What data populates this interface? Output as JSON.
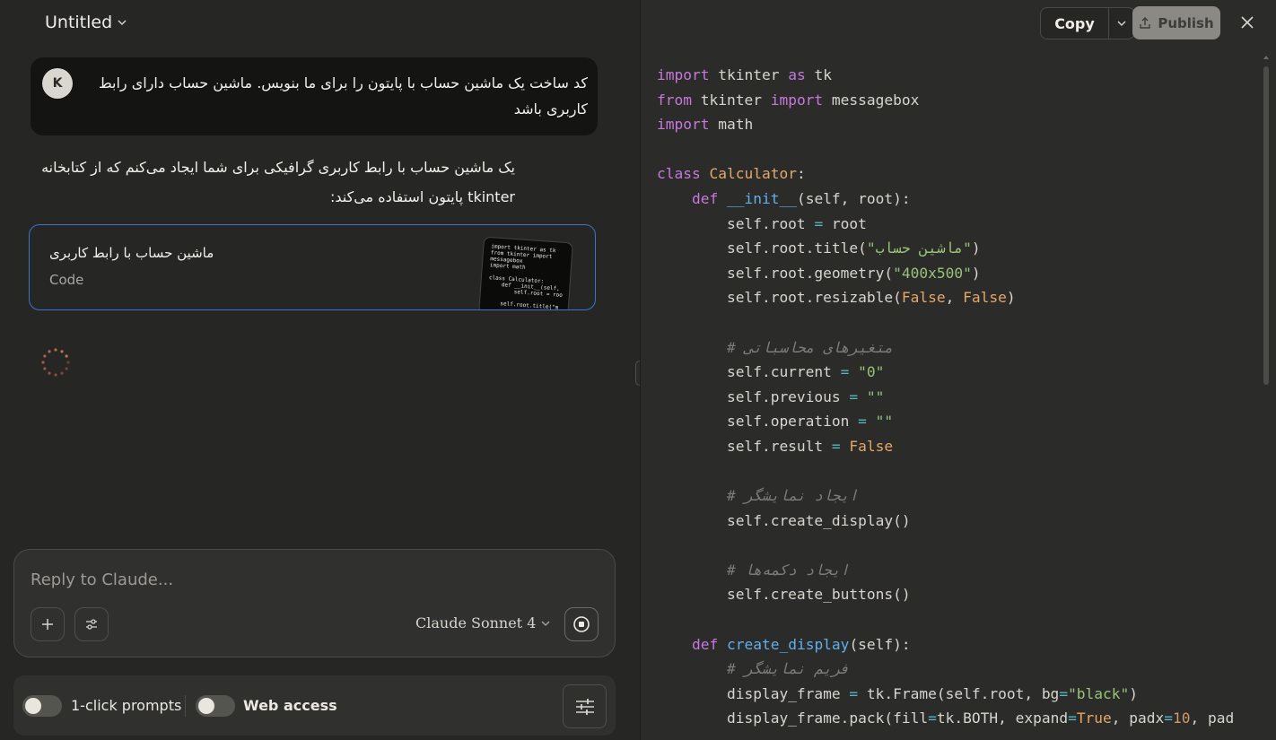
{
  "header": {
    "title": "Untitled"
  },
  "chat": {
    "user": {
      "avatar_letter": "K",
      "text": "کد ساخت یک ماشین حساب با پایتون را برای ما بنویس. ماشین حساب دارای رابط کاربری باشد"
    },
    "assistant": {
      "text": "یک ماشین حساب با رابط کاربری گرافیکی برای شما ایجاد می‌کنم که از کتابخانه tkinter پایتون استفاده می‌کند:"
    },
    "artifact": {
      "title": "ماشین حساب با رابط کاربری",
      "type": "Code",
      "thumbnail_code": "import tkinter as tk\nfrom tkinter import\nmessagebox\nimport math\n\nclass Calculator:\n    def __init__(self,\n        self.root = roo\n\n    self.root.title(\"m"
    }
  },
  "composer": {
    "placeholder": "Reply to Claude...",
    "model": "Claude Sonnet 4"
  },
  "bottom_bar": {
    "one_click_label": "1-click prompts",
    "web_access_label": "Web access"
  },
  "artifact_panel": {
    "copy_label": "Copy",
    "publish_label": "Publish",
    "code_lines": [
      [
        [
          "kw",
          "import"
        ],
        [
          "p",
          " tkinter "
        ],
        [
          "kw",
          "as"
        ],
        [
          "p",
          " tk"
        ]
      ],
      [
        [
          "kw",
          "from"
        ],
        [
          "p",
          " tkinter "
        ],
        [
          "kw",
          "import"
        ],
        [
          "p",
          " messagebox"
        ]
      ],
      [
        [
          "kw",
          "import"
        ],
        [
          "p",
          " math"
        ]
      ],
      [],
      [
        [
          "kw",
          "class"
        ],
        [
          "p",
          " "
        ],
        [
          "cls",
          "Calculator"
        ],
        [
          "p",
          ":"
        ]
      ],
      [
        [
          "p",
          "    "
        ],
        [
          "kw",
          "def"
        ],
        [
          "p",
          " "
        ],
        [
          "fn",
          "__init__"
        ],
        [
          "p",
          "(self, root):"
        ]
      ],
      [
        [
          "p",
          "        self.root "
        ],
        [
          "op",
          "="
        ],
        [
          "p",
          " root"
        ]
      ],
      [
        [
          "p",
          "        self.root.title("
        ],
        [
          "str",
          "\"ماشین حساب\""
        ],
        [
          "p",
          ")"
        ]
      ],
      [
        [
          "p",
          "        self.root.geometry("
        ],
        [
          "str",
          "\"400x500\""
        ],
        [
          "p",
          ")"
        ]
      ],
      [
        [
          "p",
          "        self.root.resizable("
        ],
        [
          "bool",
          "False"
        ],
        [
          "p",
          ", "
        ],
        [
          "bool",
          "False"
        ],
        [
          "p",
          ")"
        ]
      ],
      [],
      [
        [
          "p",
          "        "
        ],
        [
          "cm",
          "# متغیرهای محاسباتی"
        ]
      ],
      [
        [
          "p",
          "        self.current "
        ],
        [
          "op",
          "="
        ],
        [
          "p",
          " "
        ],
        [
          "str",
          "\"0\""
        ]
      ],
      [
        [
          "p",
          "        self.previous "
        ],
        [
          "op",
          "="
        ],
        [
          "p",
          " "
        ],
        [
          "str",
          "\"\""
        ]
      ],
      [
        [
          "p",
          "        self.operation "
        ],
        [
          "op",
          "="
        ],
        [
          "p",
          " "
        ],
        [
          "str",
          "\"\""
        ]
      ],
      [
        [
          "p",
          "        self.result "
        ],
        [
          "op",
          "="
        ],
        [
          "p",
          " "
        ],
        [
          "bool",
          "False"
        ]
      ],
      [],
      [
        [
          "p",
          "        "
        ],
        [
          "cm",
          "# ایجاد نمایشگر"
        ]
      ],
      [
        [
          "p",
          "        self.create_display()"
        ]
      ],
      [],
      [
        [
          "p",
          "        "
        ],
        [
          "cm",
          "# ایجاد دکمه‌ها"
        ]
      ],
      [
        [
          "p",
          "        self.create_buttons()"
        ]
      ],
      [],
      [
        [
          "p",
          "    "
        ],
        [
          "kw",
          "def"
        ],
        [
          "p",
          " "
        ],
        [
          "fn",
          "create_display"
        ],
        [
          "p",
          "(self):"
        ]
      ],
      [
        [
          "p",
          "        "
        ],
        [
          "cm",
          "# فریم نمایشگر"
        ]
      ],
      [
        [
          "p",
          "        display_frame "
        ],
        [
          "op",
          "="
        ],
        [
          "p",
          " tk.Frame(self.root, bg"
        ],
        [
          "op",
          "="
        ],
        [
          "str",
          "\"black\""
        ],
        [
          "p",
          ")"
        ]
      ],
      [
        [
          "p",
          "        display_frame.pack(fill"
        ],
        [
          "op",
          "="
        ],
        [
          "p",
          "tk.BOTH, expand"
        ],
        [
          "op",
          "="
        ],
        [
          "bool",
          "True"
        ],
        [
          "p",
          ", padx"
        ],
        [
          "op",
          "="
        ],
        [
          "num",
          "10"
        ],
        [
          "p",
          ", pad"
        ]
      ]
    ]
  }
}
